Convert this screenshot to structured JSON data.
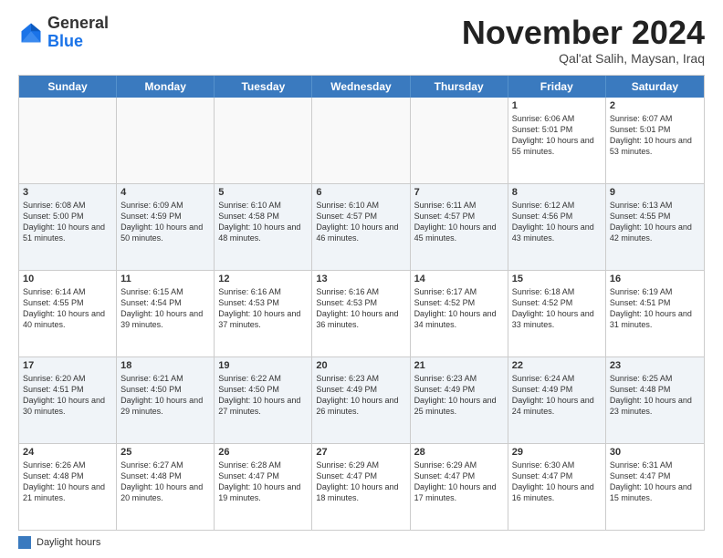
{
  "logo": {
    "line1": "General",
    "line2": "Blue"
  },
  "title": "November 2024",
  "subtitle": "Qal'at Salih, Maysan, Iraq",
  "header_days": [
    "Sunday",
    "Monday",
    "Tuesday",
    "Wednesday",
    "Thursday",
    "Friday",
    "Saturday"
  ],
  "footer_label": "Daylight hours",
  "weeks": [
    [
      {
        "day": "",
        "text": ""
      },
      {
        "day": "",
        "text": ""
      },
      {
        "day": "",
        "text": ""
      },
      {
        "day": "",
        "text": ""
      },
      {
        "day": "",
        "text": ""
      },
      {
        "day": "1",
        "text": "Sunrise: 6:06 AM\nSunset: 5:01 PM\nDaylight: 10 hours and 55 minutes."
      },
      {
        "day": "2",
        "text": "Sunrise: 6:07 AM\nSunset: 5:01 PM\nDaylight: 10 hours and 53 minutes."
      }
    ],
    [
      {
        "day": "3",
        "text": "Sunrise: 6:08 AM\nSunset: 5:00 PM\nDaylight: 10 hours and 51 minutes."
      },
      {
        "day": "4",
        "text": "Sunrise: 6:09 AM\nSunset: 4:59 PM\nDaylight: 10 hours and 50 minutes."
      },
      {
        "day": "5",
        "text": "Sunrise: 6:10 AM\nSunset: 4:58 PM\nDaylight: 10 hours and 48 minutes."
      },
      {
        "day": "6",
        "text": "Sunrise: 6:10 AM\nSunset: 4:57 PM\nDaylight: 10 hours and 46 minutes."
      },
      {
        "day": "7",
        "text": "Sunrise: 6:11 AM\nSunset: 4:57 PM\nDaylight: 10 hours and 45 minutes."
      },
      {
        "day": "8",
        "text": "Sunrise: 6:12 AM\nSunset: 4:56 PM\nDaylight: 10 hours and 43 minutes."
      },
      {
        "day": "9",
        "text": "Sunrise: 6:13 AM\nSunset: 4:55 PM\nDaylight: 10 hours and 42 minutes."
      }
    ],
    [
      {
        "day": "10",
        "text": "Sunrise: 6:14 AM\nSunset: 4:55 PM\nDaylight: 10 hours and 40 minutes."
      },
      {
        "day": "11",
        "text": "Sunrise: 6:15 AM\nSunset: 4:54 PM\nDaylight: 10 hours and 39 minutes."
      },
      {
        "day": "12",
        "text": "Sunrise: 6:16 AM\nSunset: 4:53 PM\nDaylight: 10 hours and 37 minutes."
      },
      {
        "day": "13",
        "text": "Sunrise: 6:16 AM\nSunset: 4:53 PM\nDaylight: 10 hours and 36 minutes."
      },
      {
        "day": "14",
        "text": "Sunrise: 6:17 AM\nSunset: 4:52 PM\nDaylight: 10 hours and 34 minutes."
      },
      {
        "day": "15",
        "text": "Sunrise: 6:18 AM\nSunset: 4:52 PM\nDaylight: 10 hours and 33 minutes."
      },
      {
        "day": "16",
        "text": "Sunrise: 6:19 AM\nSunset: 4:51 PM\nDaylight: 10 hours and 31 minutes."
      }
    ],
    [
      {
        "day": "17",
        "text": "Sunrise: 6:20 AM\nSunset: 4:51 PM\nDaylight: 10 hours and 30 minutes."
      },
      {
        "day": "18",
        "text": "Sunrise: 6:21 AM\nSunset: 4:50 PM\nDaylight: 10 hours and 29 minutes."
      },
      {
        "day": "19",
        "text": "Sunrise: 6:22 AM\nSunset: 4:50 PM\nDaylight: 10 hours and 27 minutes."
      },
      {
        "day": "20",
        "text": "Sunrise: 6:23 AM\nSunset: 4:49 PM\nDaylight: 10 hours and 26 minutes."
      },
      {
        "day": "21",
        "text": "Sunrise: 6:23 AM\nSunset: 4:49 PM\nDaylight: 10 hours and 25 minutes."
      },
      {
        "day": "22",
        "text": "Sunrise: 6:24 AM\nSunset: 4:49 PM\nDaylight: 10 hours and 24 minutes."
      },
      {
        "day": "23",
        "text": "Sunrise: 6:25 AM\nSunset: 4:48 PM\nDaylight: 10 hours and 23 minutes."
      }
    ],
    [
      {
        "day": "24",
        "text": "Sunrise: 6:26 AM\nSunset: 4:48 PM\nDaylight: 10 hours and 21 minutes."
      },
      {
        "day": "25",
        "text": "Sunrise: 6:27 AM\nSunset: 4:48 PM\nDaylight: 10 hours and 20 minutes."
      },
      {
        "day": "26",
        "text": "Sunrise: 6:28 AM\nSunset: 4:47 PM\nDaylight: 10 hours and 19 minutes."
      },
      {
        "day": "27",
        "text": "Sunrise: 6:29 AM\nSunset: 4:47 PM\nDaylight: 10 hours and 18 minutes."
      },
      {
        "day": "28",
        "text": "Sunrise: 6:29 AM\nSunset: 4:47 PM\nDaylight: 10 hours and 17 minutes."
      },
      {
        "day": "29",
        "text": "Sunrise: 6:30 AM\nSunset: 4:47 PM\nDaylight: 10 hours and 16 minutes."
      },
      {
        "day": "30",
        "text": "Sunrise: 6:31 AM\nSunset: 4:47 PM\nDaylight: 10 hours and 15 minutes."
      }
    ]
  ]
}
